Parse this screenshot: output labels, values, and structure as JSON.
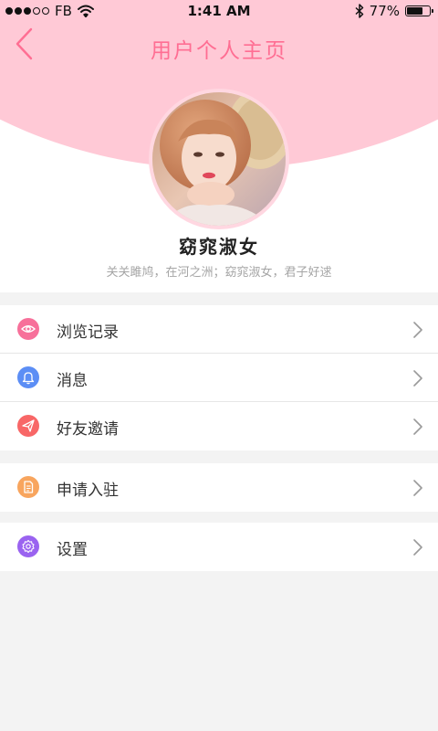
{
  "status_bar": {
    "carrier": "FB",
    "signal_bars_filled": 3,
    "signal_bars_total": 5,
    "time": "1:41 AM",
    "battery_text": "77%",
    "battery_level": 0.77,
    "icons": [
      "wifi-icon",
      "bluetooth-icon",
      "battery-icon"
    ]
  },
  "nav": {
    "title": "用户个人主页",
    "back_icon": "chevron-left-icon"
  },
  "profile": {
    "name": "窈窕淑女",
    "bio": "关关雎鸠，在河之洲；窈窕淑女，君子好逑"
  },
  "menu_groups": [
    {
      "items": [
        {
          "label": "浏览记录",
          "icon": "eye-icon",
          "icon_color": "#f7709a"
        },
        {
          "label": "消息",
          "icon": "bell-icon",
          "icon_color": "#5c8ef5"
        },
        {
          "label": "好友邀请",
          "icon": "paper-plane-icon",
          "icon_color": "#f86767"
        }
      ]
    },
    {
      "items": [
        {
          "label": "申请入驻",
          "icon": "document-icon",
          "icon_color": "#f8a55e"
        }
      ]
    },
    {
      "items": [
        {
          "label": "设置",
          "icon": "gear-icon",
          "icon_color": "#9a63f0"
        }
      ]
    }
  ],
  "colors": {
    "accent_pink": "#ff6e93",
    "header_pink": "#ffc9d6",
    "page_background": "#f3f3f3"
  }
}
